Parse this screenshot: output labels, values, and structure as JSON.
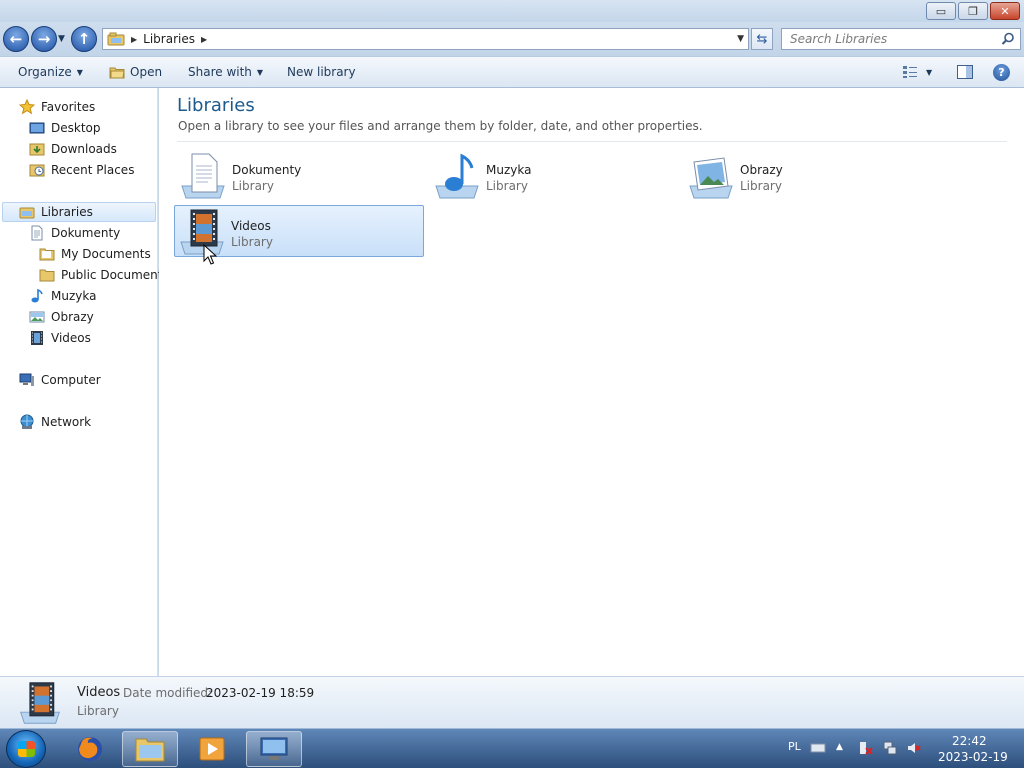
{
  "window": {
    "caption_buttons": {
      "minimize": "▭",
      "maximize": "❐",
      "close": "✕"
    }
  },
  "address": {
    "crumb": "Libraries",
    "search_placeholder": "Search Libraries"
  },
  "toolbar": {
    "organize": "Organize",
    "open": "Open",
    "share_with": "Share with",
    "new_library": "New library",
    "help": "?"
  },
  "nav": {
    "favorites": "Favorites",
    "desktop": "Desktop",
    "downloads": "Downloads",
    "recent_places": "Recent Places",
    "libraries": "Libraries",
    "dokumenty": "Dokumenty",
    "my_documents": "My Documents",
    "public_documents": "Public Documents",
    "muzyka": "Muzyka",
    "obrazy": "Obrazy",
    "videos": "Videos",
    "computer": "Computer",
    "network": "Network"
  },
  "main": {
    "title": "Libraries",
    "subtitle": "Open a library to see your files and arrange them by folder, date, and other properties.",
    "libraries": [
      {
        "name": "Dokumenty",
        "type": "Library",
        "icon": "documents-library-icon"
      },
      {
        "name": "Muzyka",
        "type": "Library",
        "icon": "music-library-icon"
      },
      {
        "name": "Obrazy",
        "type": "Library",
        "icon": "pictures-library-icon"
      },
      {
        "name": "Videos",
        "type": "Library",
        "icon": "videos-library-icon",
        "selected": true
      }
    ]
  },
  "details": {
    "name": "Videos",
    "date_label": "Date modified:",
    "date_value": "2023-02-19 18:59",
    "type": "Library"
  },
  "taskbar": {
    "language": "PL",
    "time": "22:42",
    "date": "2023-02-19"
  },
  "colors": {
    "title_accent": "#1e5a8c",
    "selection_fill": "#c9e0f9",
    "selection_border": "#7aa7dc",
    "taskbar": "#2d4f7c"
  }
}
